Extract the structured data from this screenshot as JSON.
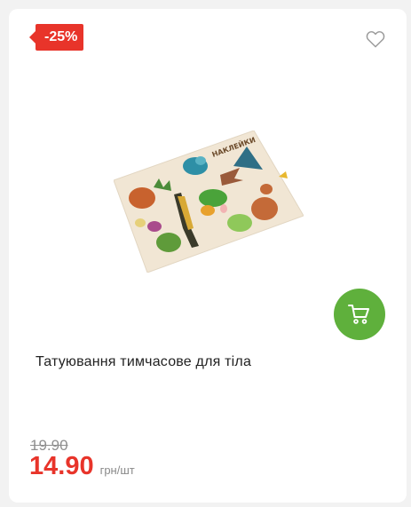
{
  "product": {
    "discount_badge": "-25%",
    "title": "Татуювання тимчасове для тіла",
    "old_price": "19.90",
    "price": "14.90",
    "unit": "грн/шт",
    "sheet_label": "НАКЛЕЙКИ"
  },
  "icons": {
    "favorite": "heart-outline-icon",
    "cart": "shopping-cart-icon"
  },
  "colors": {
    "accent_red": "#e8342a",
    "cart_green": "#5fb03c"
  }
}
